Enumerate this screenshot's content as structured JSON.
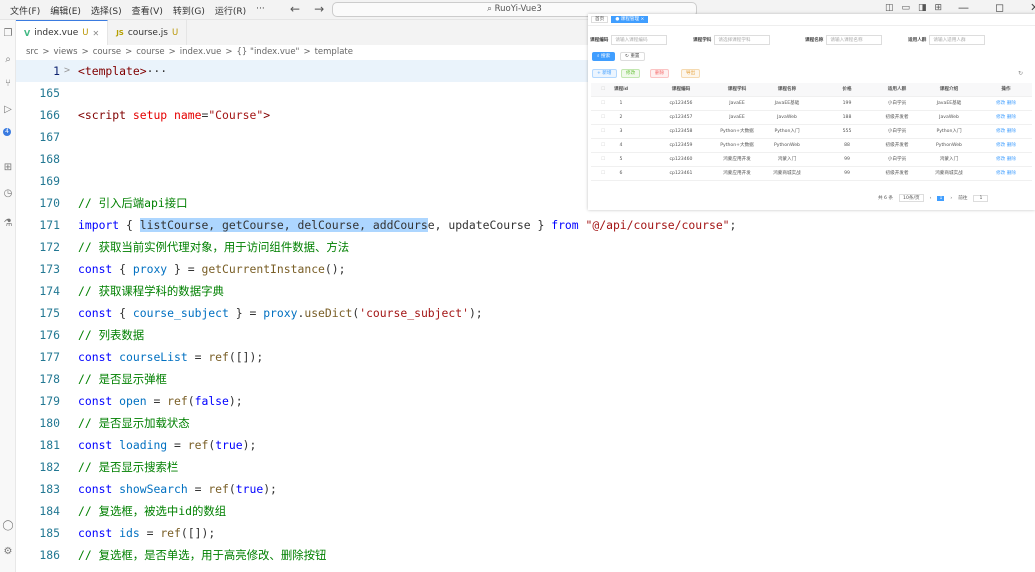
{
  "window": {
    "title": "RuoYi-Vue3",
    "menu": [
      "文件(F)",
      "编辑(E)",
      "选择(S)",
      "查看(V)",
      "转到(G)",
      "运行(R)",
      "···"
    ],
    "nav": [
      "←",
      "→"
    ],
    "layout_icons": [
      "◫",
      "▭",
      "◨",
      "⊞"
    ],
    "controls": [
      "—",
      "◻",
      "✕"
    ]
  },
  "activity_badge": "4",
  "tabs": [
    {
      "icon": "V",
      "label": "index.vue",
      "status": "U"
    },
    {
      "icon": "JS",
      "label": "course.js",
      "status": "U"
    }
  ],
  "breadcrumb": [
    "src",
    ">",
    "views",
    ">",
    "course",
    ">",
    "course",
    ">",
    "index.vue",
    ">",
    "{} \"index.vue\"",
    ">",
    "template"
  ],
  "editor": {
    "lines": [
      {
        "n": "1",
        "fold": ">",
        "segments": [
          {
            "c": "tag",
            "t": "<template>"
          },
          {
            "c": "",
            "t": "···"
          }
        ]
      },
      {
        "n": "165",
        "segments": []
      },
      {
        "n": "166",
        "segments": [
          {
            "c": "tag",
            "t": "<script"
          },
          {
            "c": "",
            "t": " "
          },
          {
            "c": "attr",
            "t": "setup"
          },
          {
            "c": "",
            "t": " "
          },
          {
            "c": "attr",
            "t": "name"
          },
          {
            "c": "",
            "t": "="
          },
          {
            "c": "str",
            "t": "\"Course\""
          },
          {
            "c": "tag",
            "t": ">"
          }
        ]
      },
      {
        "n": "167",
        "segments": []
      },
      {
        "n": "168",
        "segments": []
      },
      {
        "n": "169",
        "segments": []
      },
      {
        "n": "170",
        "segments": [
          {
            "c": "cm",
            "t": "// 引入后端api接口"
          }
        ]
      },
      {
        "n": "171",
        "segments": [
          {
            "c": "kw",
            "t": "import"
          },
          {
            "c": "",
            "t": " { "
          },
          {
            "c": "sel",
            "t": "listCourse, getCourse, delCourse, addCours"
          },
          {
            "c": "",
            "t": "e, updateCourse } "
          },
          {
            "c": "kw",
            "t": "from"
          },
          {
            "c": "",
            "t": " "
          },
          {
            "c": "str",
            "t": "\"@/api/course/course\""
          },
          {
            "c": "",
            "t": ";"
          }
        ]
      },
      {
        "n": "172",
        "segments": [
          {
            "c": "cm",
            "t": "// 获取当前实例代理对象，用于访问组件数据、方法"
          }
        ]
      },
      {
        "n": "173",
        "segments": [
          {
            "c": "kw",
            "t": "const"
          },
          {
            "c": "",
            "t": " { "
          },
          {
            "c": "var",
            "t": "proxy"
          },
          {
            "c": "",
            "t": " } = "
          },
          {
            "c": "fn",
            "t": "getCurrentInstance"
          },
          {
            "c": "",
            "t": "();"
          }
        ]
      },
      {
        "n": "174",
        "segments": [
          {
            "c": "cm",
            "t": "// 获取课程学科的数据字典"
          }
        ]
      },
      {
        "n": "175",
        "segments": [
          {
            "c": "kw",
            "t": "const"
          },
          {
            "c": "",
            "t": " { "
          },
          {
            "c": "var",
            "t": "course_subject"
          },
          {
            "c": "",
            "t": " } = "
          },
          {
            "c": "var",
            "t": "proxy"
          },
          {
            "c": "",
            "t": "."
          },
          {
            "c": "fn",
            "t": "useDict"
          },
          {
            "c": "",
            "t": "("
          },
          {
            "c": "str",
            "t": "'course_subject'"
          },
          {
            "c": "",
            "t": ");"
          }
        ]
      },
      {
        "n": "176",
        "segments": [
          {
            "c": "cm",
            "t": "// 列表数据"
          }
        ]
      },
      {
        "n": "177",
        "segments": [
          {
            "c": "kw",
            "t": "const"
          },
          {
            "c": "",
            "t": " "
          },
          {
            "c": "var",
            "t": "courseList"
          },
          {
            "c": "",
            "t": " = "
          },
          {
            "c": "fn",
            "t": "ref"
          },
          {
            "c": "",
            "t": "([]);"
          }
        ]
      },
      {
        "n": "178",
        "segments": [
          {
            "c": "cm",
            "t": "// 是否显示弹框"
          }
        ]
      },
      {
        "n": "179",
        "segments": [
          {
            "c": "kw",
            "t": "const"
          },
          {
            "c": "",
            "t": " "
          },
          {
            "c": "var",
            "t": "open"
          },
          {
            "c": "",
            "t": " = "
          },
          {
            "c": "fn",
            "t": "ref"
          },
          {
            "c": "",
            "t": "("
          },
          {
            "c": "kw",
            "t": "false"
          },
          {
            "c": "",
            "t": ");"
          }
        ]
      },
      {
        "n": "180",
        "segments": [
          {
            "c": "cm",
            "t": "// 是否显示加载状态"
          }
        ]
      },
      {
        "n": "181",
        "segments": [
          {
            "c": "kw",
            "t": "const"
          },
          {
            "c": "",
            "t": " "
          },
          {
            "c": "var",
            "t": "loading"
          },
          {
            "c": "",
            "t": " = "
          },
          {
            "c": "fn",
            "t": "ref"
          },
          {
            "c": "",
            "t": "("
          },
          {
            "c": "kw",
            "t": "true"
          },
          {
            "c": "",
            "t": ");"
          }
        ]
      },
      {
        "n": "182",
        "segments": [
          {
            "c": "cm",
            "t": "// 是否显示搜索栏"
          }
        ]
      },
      {
        "n": "183",
        "segments": [
          {
            "c": "kw",
            "t": "const"
          },
          {
            "c": "",
            "t": " "
          },
          {
            "c": "var",
            "t": "showSearch"
          },
          {
            "c": "",
            "t": " = "
          },
          {
            "c": "fn",
            "t": "ref"
          },
          {
            "c": "",
            "t": "("
          },
          {
            "c": "kw",
            "t": "true"
          },
          {
            "c": "",
            "t": ");"
          }
        ]
      },
      {
        "n": "184",
        "segments": [
          {
            "c": "cm",
            "t": "// 复选框，被选中id的数组"
          }
        ]
      },
      {
        "n": "185",
        "segments": [
          {
            "c": "kw",
            "t": "const"
          },
          {
            "c": "",
            "t": " "
          },
          {
            "c": "var",
            "t": "ids"
          },
          {
            "c": "",
            "t": " = "
          },
          {
            "c": "fn",
            "t": "ref"
          },
          {
            "c": "",
            "t": "([]);"
          }
        ]
      },
      {
        "n": "186",
        "segments": [
          {
            "c": "cm",
            "t": "// 复选框，是否单选，用于高亮修改、删除按钮"
          }
        ]
      }
    ]
  },
  "preview": {
    "tags": [
      "首页",
      "● 课程管理 ×"
    ],
    "search": [
      {
        "label": "课程编码",
        "placeholder": "请输入课程编码"
      },
      {
        "label": "课程学科",
        "placeholder": "请选择课程学科"
      },
      {
        "label": "课程名称",
        "placeholder": "请输入课程名称"
      },
      {
        "label": "适用人群",
        "placeholder": "请输入适用人群"
      }
    ],
    "search_buttons": [
      "搜索",
      "重置"
    ],
    "action_buttons": [
      "+ 新增",
      "修改",
      "删除",
      "导出"
    ],
    "columns": [
      "课程id",
      "课程编码",
      "课程学科",
      "课程名称",
      "价格",
      "适用人群",
      "课程介绍",
      "操作"
    ],
    "rows": [
      [
        "1",
        "cp123456",
        "JavaEE",
        "JavaEE基础",
        "199",
        "小白学员",
        "JavaEE基础",
        "修改 删除"
      ],
      [
        "2",
        "cp123457",
        "JavaEE",
        "JavaWeb",
        "188",
        "初级开发者",
        "JavaWeb",
        "修改 删除"
      ],
      [
        "3",
        "cp123458",
        "Python+大数据",
        "Python入门",
        "555",
        "小白学员",
        "Python入门",
        "修改 删除"
      ],
      [
        "4",
        "cp123459",
        "Python+大数据",
        "PythonWeb",
        "88",
        "初级开发者",
        "PythonWeb",
        "修改 删除"
      ],
      [
        "5",
        "cp123460",
        "鸿蒙应用开发",
        "鸿蒙入门",
        "99",
        "小白学员",
        "鸿蒙入门",
        "修改 删除"
      ],
      [
        "6",
        "cp123461",
        "鸿蒙应用开发",
        "鸿蒙商城实战",
        "99",
        "初级开发者",
        "鸿蒙商城实战",
        "修改 删除"
      ]
    ],
    "pager": {
      "total": "共 6 条",
      "size": "10条/页",
      "page": "1",
      "goto": "前往",
      "goto_value": "1"
    }
  },
  "colors": {
    "accent": "#3a7be0",
    "selection": "#add6ff",
    "element_primary": "#409eff"
  }
}
